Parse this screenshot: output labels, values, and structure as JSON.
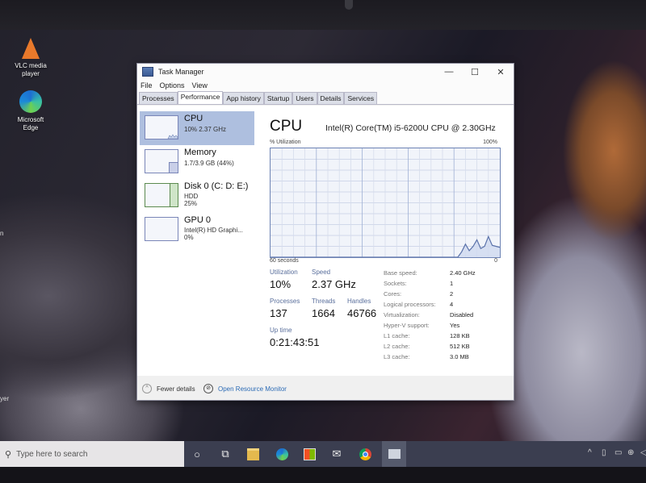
{
  "desktop": {
    "icons": [
      {
        "label_line1": "VLC media",
        "label_line2": "player",
        "icon": "vlc-icon"
      },
      {
        "label_line1": "Microsoft",
        "label_line2": "Edge",
        "icon": "edge-icon"
      }
    ],
    "left_fragments": [
      "n",
      "yer"
    ]
  },
  "window": {
    "title": "Task Manager",
    "controls": {
      "minimize": "—",
      "maximize": "☐",
      "close": "✕"
    },
    "menu": [
      "File",
      "Options",
      "View"
    ],
    "tabs": [
      "Processes",
      "Performance",
      "App history",
      "Startup",
      "Users",
      "Details",
      "Services"
    ],
    "active_tab": "Performance"
  },
  "sidebar": {
    "items": [
      {
        "label": "CPU",
        "sub1": "10% 2.37 GHz",
        "sub2": "",
        "selected": true
      },
      {
        "label": "Memory",
        "sub1": "1.7/3.9 GB (44%)",
        "sub2": ""
      },
      {
        "label": "Disk 0 (C: D: E:)",
        "sub1": "HDD",
        "sub2": "25%"
      },
      {
        "label": "GPU 0",
        "sub1": "Intel(R) HD Graphi...",
        "sub2": "0%"
      }
    ]
  },
  "cpu": {
    "title": "CPU",
    "model": "Intel(R) Core(TM) i5-6200U CPU @ 2.30GHz",
    "util_axis_label": "% Utilization",
    "util_max_label": "100%",
    "time_label": "60 seconds",
    "time_zero_label": "0",
    "stats": {
      "utilization_label": "Utilization",
      "utilization": "10%",
      "speed_label": "Speed",
      "speed": "2.37 GHz",
      "processes_label": "Processes",
      "processes": "137",
      "threads_label": "Threads",
      "threads": "1664",
      "handles_label": "Handles",
      "handles": "46766",
      "uptime_label": "Up time",
      "uptime": "0:21:43:51"
    },
    "specs": [
      {
        "label": "Base speed:",
        "value": "2.40 GHz"
      },
      {
        "label": "Sockets:",
        "value": "1"
      },
      {
        "label": "Cores:",
        "value": "2"
      },
      {
        "label": "Logical processors:",
        "value": "4"
      },
      {
        "label": "Virtualization:",
        "value": "Disabled"
      },
      {
        "label": "Hyper-V support:",
        "value": "Yes"
      },
      {
        "label": "L1 cache:",
        "value": "128 KB"
      },
      {
        "label": "L2 cache:",
        "value": "512 KB"
      },
      {
        "label": "L3 cache:",
        "value": "3.0 MB"
      }
    ],
    "history_percent": [
      0,
      0,
      0,
      0,
      0,
      0,
      0,
      0,
      0,
      0,
      0,
      0,
      0,
      0,
      0,
      0,
      0,
      0,
      0,
      0,
      0,
      0,
      0,
      0,
      0,
      0,
      0,
      0,
      0,
      0,
      0,
      0,
      0,
      0,
      0,
      0,
      0,
      0,
      0,
      0,
      0,
      0,
      0,
      0,
      0,
      0,
      0,
      0,
      0,
      0,
      5,
      12,
      6,
      10,
      16,
      8,
      10,
      19,
      11,
      10,
      9
    ]
  },
  "footer": {
    "fewer_details": "Fewer details",
    "open_resource_monitor": "Open Resource Monitor"
  },
  "taskbar": {
    "search_placeholder": "Type here to search",
    "apps": [
      "cortana-icon",
      "task-view-icon",
      "file-explorer-icon",
      "edge-icon",
      "store-icon",
      "mail-icon",
      "chrome-icon",
      "task-manager-icon"
    ]
  },
  "colors": {
    "accent_graph": "#6d83b4",
    "selected_item": "#aebfdf",
    "link": "#2c6bb5",
    "disk_green": "#5b8a4f"
  }
}
